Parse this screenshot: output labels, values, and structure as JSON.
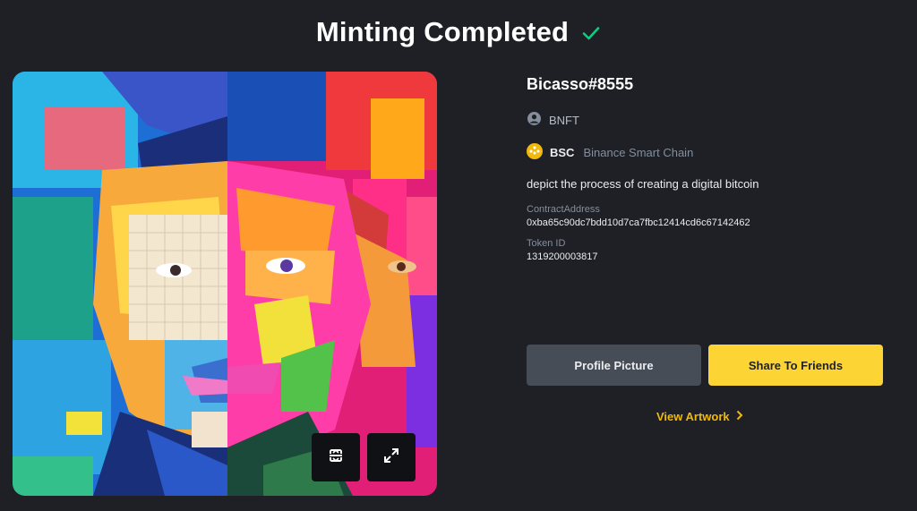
{
  "header": {
    "title": "Minting Completed",
    "check_icon": "check-icon",
    "check_color": "#0ecb81"
  },
  "artwork": {
    "alt": "Cubist colorful portrait of a young man",
    "buttons": {
      "reframe_icon": "reframe-icon",
      "expand_icon": "expand-icon"
    }
  },
  "nft": {
    "name": "Bicasso#8555",
    "creator": "BNFT",
    "chain_code": "BSC",
    "chain_name": "Binance Smart Chain",
    "description": "depict the process of creating a digital bitcoin",
    "contract_label": "ContractAddress",
    "contract_address": "0xba65c90dc7bdd10d7ca7fbc12414cd6c67142462",
    "token_label": "Token ID",
    "token_id": "1319200003817"
  },
  "actions": {
    "profile_picture": "Profile Picture",
    "share": "Share To Friends",
    "view_artwork": "View Artwork"
  },
  "colors": {
    "accent": "#fcd535",
    "link": "#f0b90b",
    "background": "#1e2026"
  }
}
